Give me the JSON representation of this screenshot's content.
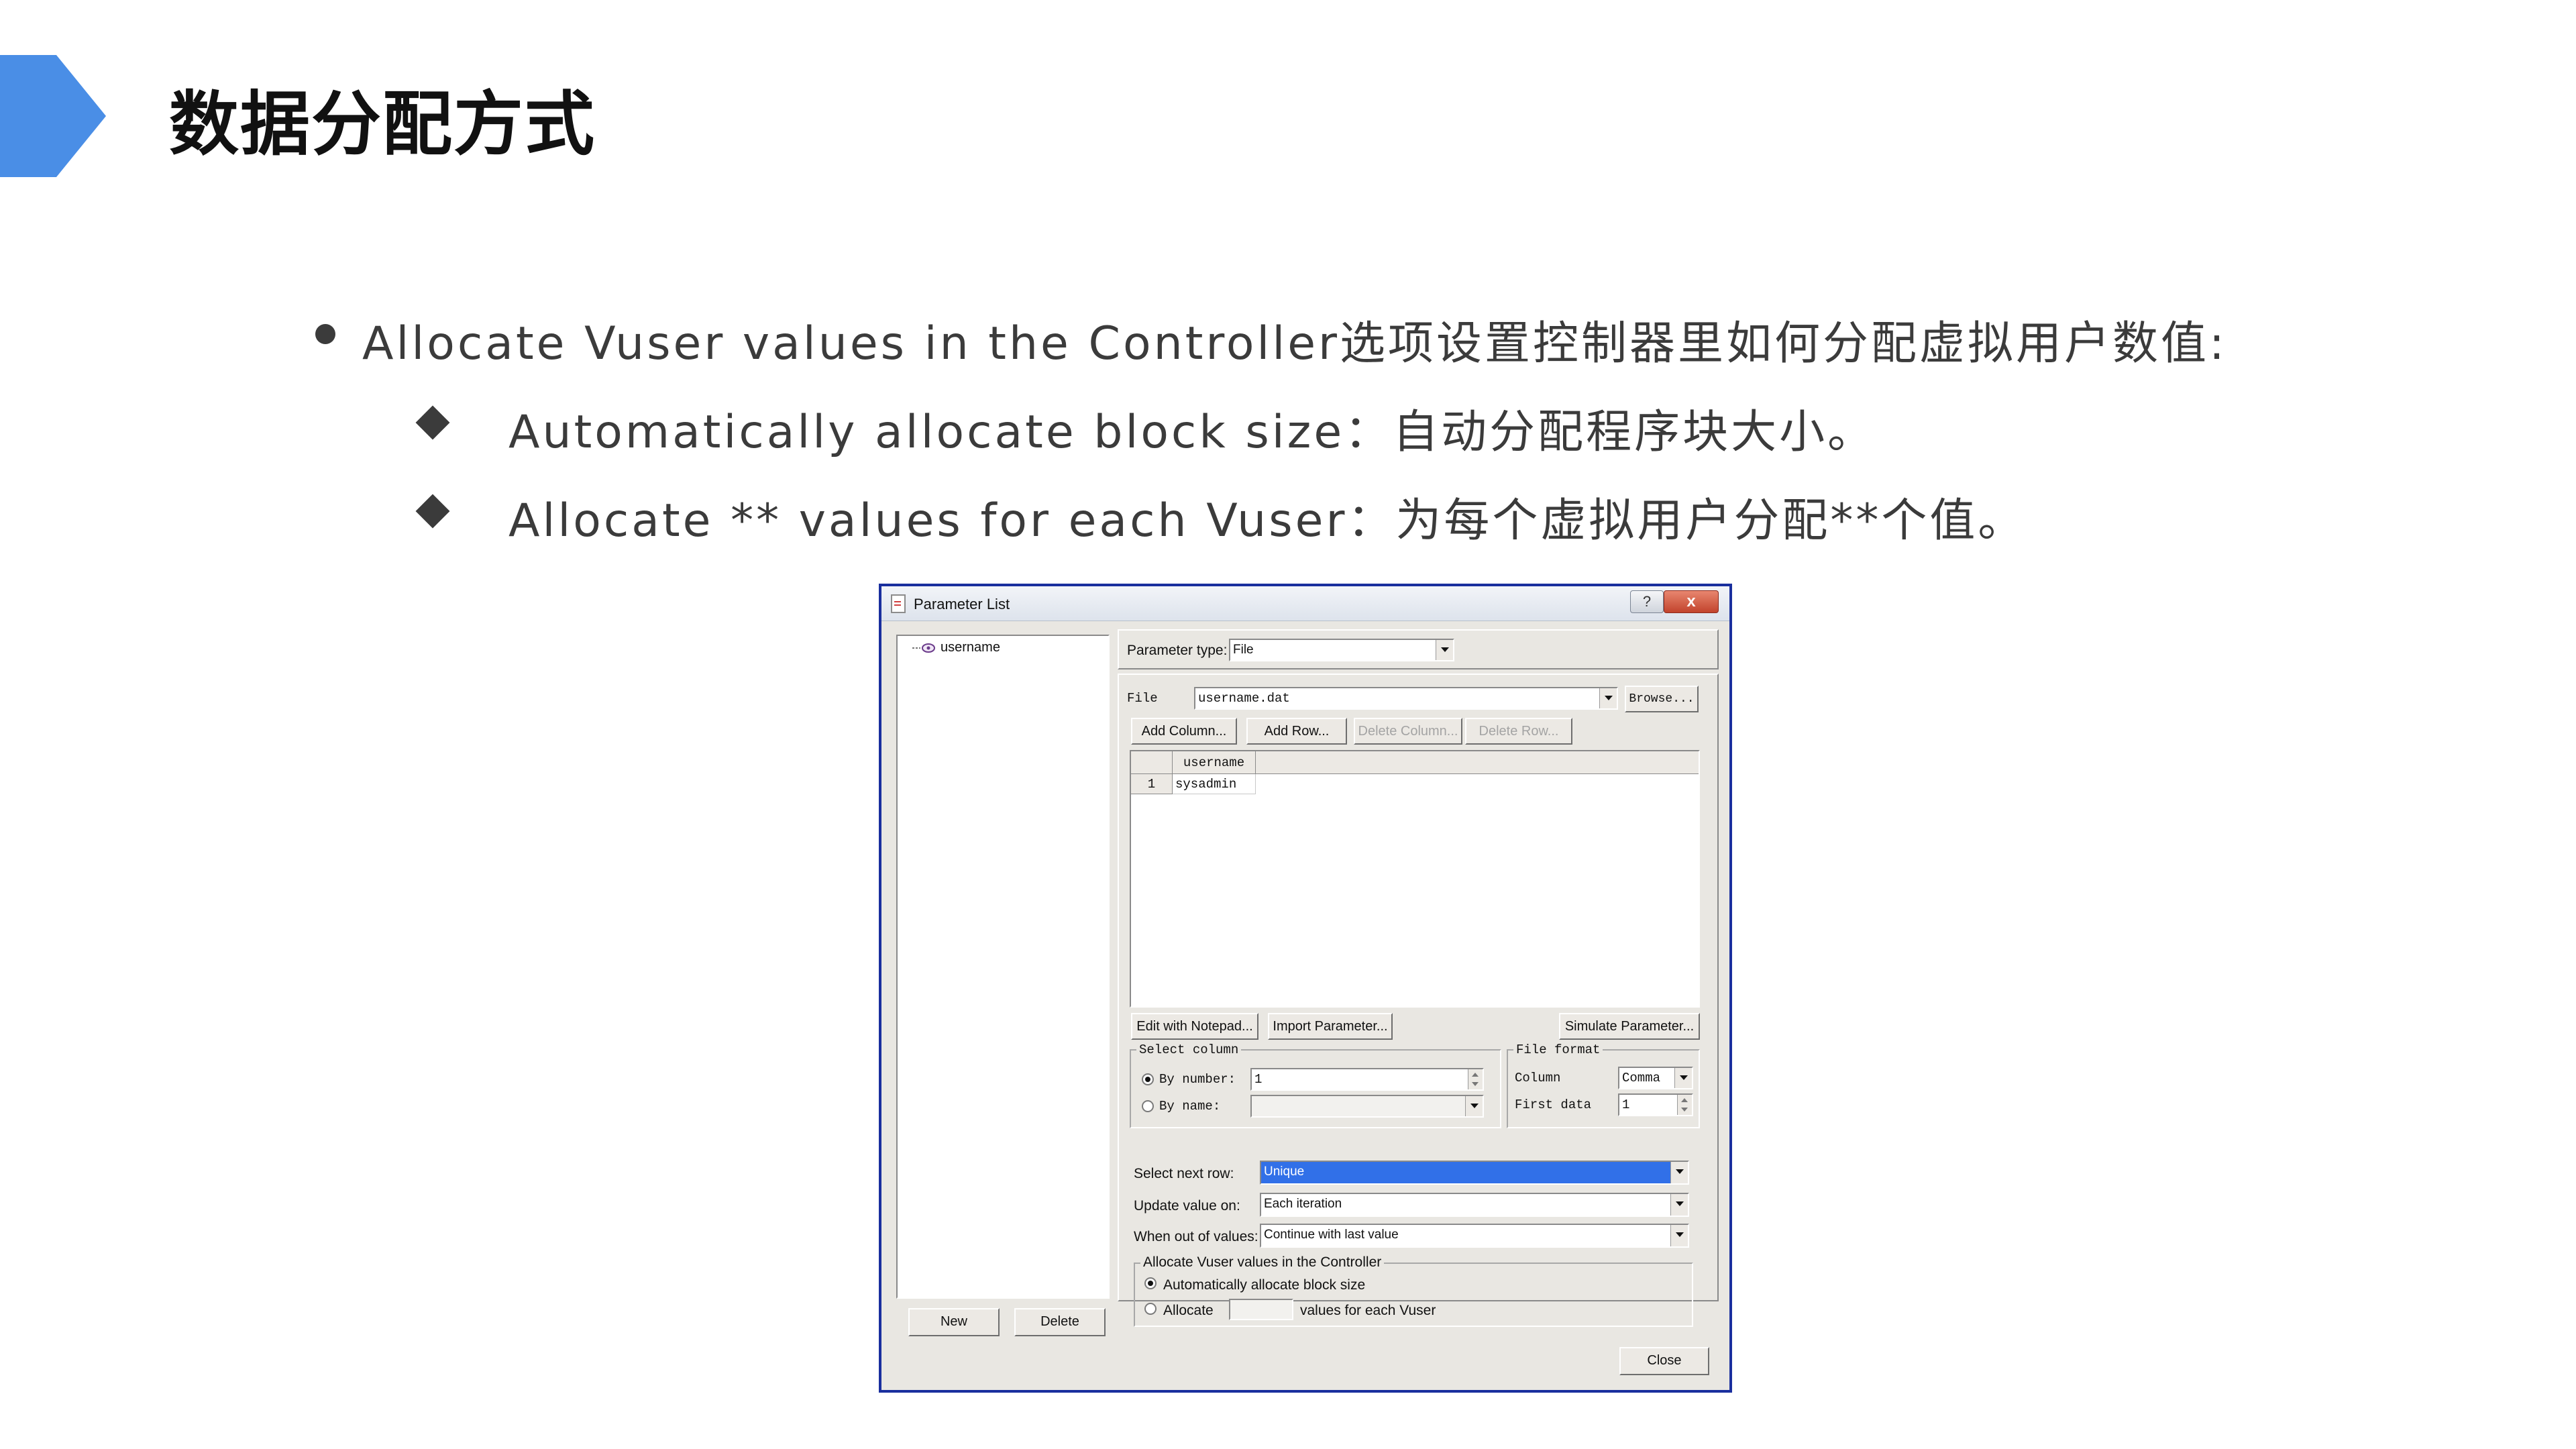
{
  "slide": {
    "title": "数据分配方式",
    "bullets": [
      "Allocate Vuser values in the Controller选项设置控制器里如何分配虚拟用户数值:",
      "Automatically allocate block size：自动分配程序块大小。",
      "Allocate ** values for each Vuser：为每个虚拟用户分配**个值。"
    ],
    "accent_color": "#4a8ee6"
  },
  "dialog": {
    "title": "Parameter List",
    "help_label": "?",
    "close_x_label": "x",
    "parameters": [
      "username"
    ],
    "new_label": "New",
    "delete_label": "Delete",
    "parameter_type_label": "Parameter type:",
    "parameter_type_value": "File",
    "file_label": "File",
    "file_value": "username.dat",
    "browse_label": "Browse...",
    "add_column_label": "Add Column...",
    "add_row_label": "Add Row...",
    "delete_column_label": "Delete Column...",
    "delete_row_label": "Delete Row...",
    "table": {
      "columns": [
        "username"
      ],
      "rows": [
        {
          "num": "1",
          "values": [
            "sysadmin"
          ]
        }
      ]
    },
    "edit_notepad_label": "Edit with Notepad...",
    "import_parameter_label": "Import Parameter...",
    "simulate_parameter_label": "Simulate Parameter...",
    "select_column": {
      "title": "Select column",
      "by_number_label": "By number:",
      "by_number_value": "1",
      "by_name_label": "By name:",
      "by_name_value": ""
    },
    "file_format": {
      "title": "File format",
      "column_label": "Column",
      "column_value": "Comma",
      "first_data_label": "First data",
      "first_data_value": "1"
    },
    "select_next_row_label": "Select next row:",
    "select_next_row_value": "Unique",
    "update_value_on_label": "Update value on:",
    "update_value_on_value": "Each iteration",
    "when_out_label": "When out of values:",
    "when_out_value": "Continue with last value",
    "allocate_group": {
      "title": "Allocate Vuser values in the Controller",
      "auto_label": "Automatically allocate block size",
      "allocate_label": "Allocate",
      "allocate_value": "",
      "each_label": "values for each Vuser"
    },
    "close_label": "Close",
    "selection_color": "#3170e8"
  }
}
